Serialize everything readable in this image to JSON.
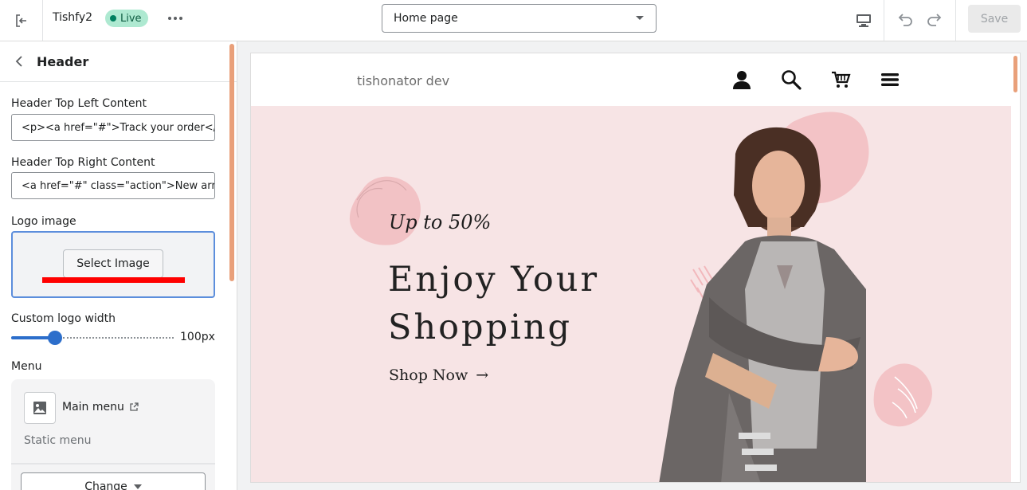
{
  "topbar": {
    "store_name": "Tishfy2",
    "status_badge": "Live",
    "template_select": "Home page",
    "save_label": "Save",
    "icons": [
      "exit-icon",
      "more-icon",
      "chevron-down-icon",
      "desktop-icon",
      "undo-icon",
      "redo-icon"
    ]
  },
  "sidebar": {
    "title": "Header",
    "fields": {
      "top_left_label": "Header Top Left Content",
      "top_left_value": "<p><a href=\"#\">Track your order</a></p>",
      "top_right_label": "Header Top Right Content",
      "top_right_value": "<a href=\"#\" class=\"action\">New arrivals</a>",
      "logo_label": "Logo image",
      "logo_button": "Select Image",
      "width_label": "Custom logo width",
      "width_value": "100px",
      "width_percent": 27,
      "menu_label": "Menu",
      "menu_name": "Main menu",
      "menu_sub": "Static menu",
      "change_label": "Change"
    }
  },
  "preview": {
    "store_name": "tishonator dev",
    "header_icons": [
      "account-icon",
      "search-icon",
      "cart-icon",
      "menu-icon"
    ],
    "hero": {
      "tagline": "Up to 50%",
      "title": "Enjoy Your Shopping",
      "link": "Shop Now",
      "link_arrow": "→"
    }
  },
  "colors": {
    "accent": "#2c6ecb",
    "live_badge": "#aee9d1",
    "hero_bg": "#f7e4e5",
    "highlight": "#ff0000",
    "scrollbar": "#e9a07a"
  }
}
